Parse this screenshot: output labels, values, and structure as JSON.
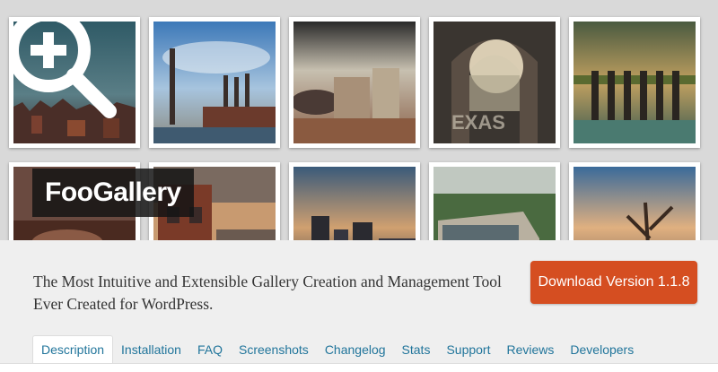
{
  "banner": {
    "title": "FooGallery",
    "thumbnails": [
      {
        "scene": "city-skyline-storm"
      },
      {
        "scene": "factory-smokestacks"
      },
      {
        "scene": "ruined-buildings"
      },
      {
        "scene": "graffiti-arch"
      },
      {
        "scene": "pier-over-water"
      },
      {
        "scene": "dark-industrial"
      },
      {
        "scene": "brick-house"
      },
      {
        "scene": "city-sunset"
      },
      {
        "scene": "rusty-van"
      },
      {
        "scene": "wrecked-car-trees"
      }
    ]
  },
  "description": "The Most Intuitive and Extensible Gallery Creation and Management Tool Ever Created for WordPress.",
  "download_label": "Download Version 1.1.8",
  "tabs": [
    {
      "label": "Description",
      "active": true
    },
    {
      "label": "Installation"
    },
    {
      "label": "FAQ"
    },
    {
      "label": "Screenshots"
    },
    {
      "label": "Changelog"
    },
    {
      "label": "Stats"
    },
    {
      "label": "Support"
    },
    {
      "label": "Reviews"
    },
    {
      "label": "Developers"
    }
  ],
  "colors": {
    "download": "#d54e21",
    "link": "#21759b",
    "banner_bg": "#d9d9d9",
    "info_bg": "#efefef"
  }
}
